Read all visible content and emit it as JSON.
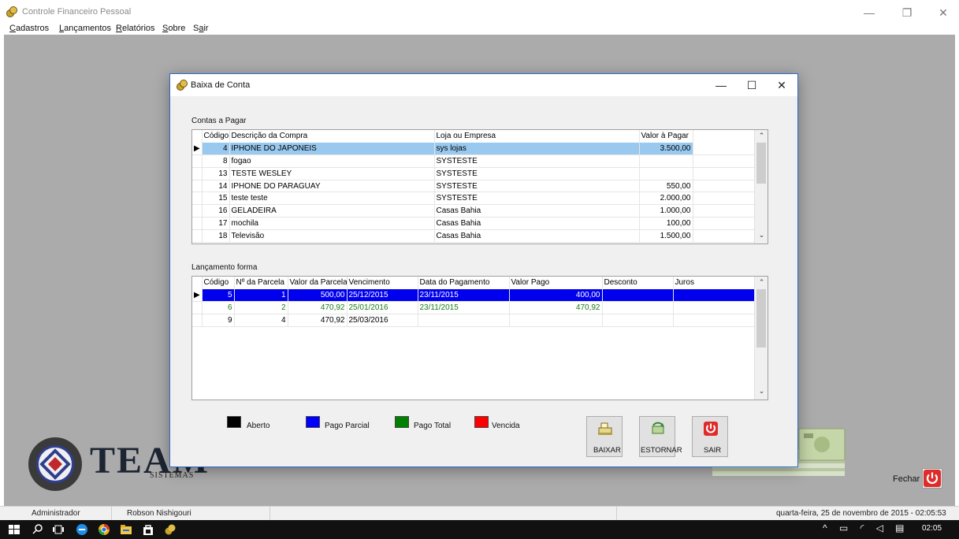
{
  "app": {
    "title": "Controle Financeiro Pessoal",
    "menu": [
      {
        "label": "Cadastros",
        "mnemonic": "C"
      },
      {
        "label": "Lançamentos",
        "mnemonic": "L"
      },
      {
        "label": "Relatórios",
        "mnemonic": "R"
      },
      {
        "label": "Sobre",
        "mnemonic": "S"
      },
      {
        "label": "Sair",
        "mnemonic": "a"
      }
    ],
    "window_controls": [
      "—",
      "❐",
      "✕"
    ]
  },
  "dialog": {
    "title": "Baixa de Conta",
    "controls": [
      "—",
      "☐",
      "✕"
    ],
    "contas_label": "Contas a Pagar",
    "contas_headers": [
      "Código",
      "Descrição da Compra",
      "Loja ou Empresa",
      "Valor à Pagar"
    ],
    "contas_rows": [
      [
        "4",
        "IPHONE DO JAPONEIS",
        "sys lojas",
        "3.500,00"
      ],
      [
        "8",
        "fogao",
        "SYSTESTE",
        ""
      ],
      [
        "13",
        "TESTE WESLEY",
        "SYSTESTE",
        ""
      ],
      [
        "14",
        "IPHONE DO PARAGUAY",
        "SYSTESTE",
        "550,00"
      ],
      [
        "15",
        "teste teste",
        "SYSTESTE",
        "2.000,00"
      ],
      [
        "16",
        "GELADEIRA",
        "Casas Bahia",
        "1.000,00"
      ],
      [
        "17",
        "mochila",
        "Casas Bahia",
        "100,00"
      ],
      [
        "18",
        "Televisão",
        "Casas Bahia",
        "1.500,00"
      ]
    ],
    "lanc_label": "Lançamento forma",
    "lanc_headers": [
      "Código",
      "Nº da Parcela",
      "Valor da Parcela",
      "Vencimento",
      "Data do Pagamento",
      "Valor Pago",
      "Desconto",
      "Juros"
    ],
    "lanc_rows": [
      [
        "5",
        "1",
        "500,00",
        "25/12/2015",
        "23/11/2015",
        "400,00",
        "",
        ""
      ],
      [
        "6",
        "2",
        "470,92",
        "25/01/2016",
        "23/11/2015",
        "470,92",
        "",
        ""
      ],
      [
        "9",
        "4",
        "470,92",
        "25/03/2016",
        "",
        "",
        "",
        ""
      ]
    ],
    "legend": [
      {
        "label": "Aberto",
        "color": "#000000"
      },
      {
        "label": "Pago Parcial",
        "color": "#0000ff"
      },
      {
        "label": "Pago Total",
        "color": "#008000"
      },
      {
        "label": "Vencida",
        "color": "#ff0000"
      }
    ],
    "buttons": {
      "baixar": "BAIXAR",
      "estornar": "ESTORNAR",
      "sair": "SAIR"
    }
  },
  "logo": {
    "text": "TEAM",
    "sub": "SISTEMAS"
  },
  "fechar_label": "Fechar",
  "status": {
    "user": "Administrador",
    "name": "Robson Nishigouri",
    "datetime": "quarta-feira, 25 de novembro de 2015 - 02:05:53"
  },
  "taskbar": {
    "time": "02:05"
  }
}
